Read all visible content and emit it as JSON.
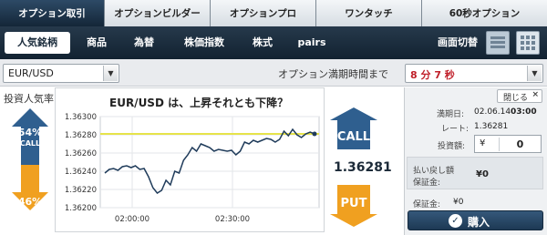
{
  "top_tabs": [
    {
      "label": "オプション取引",
      "active": true
    },
    {
      "label": "オプションビルダー",
      "active": false
    },
    {
      "label": "オプションプロ",
      "active": false
    },
    {
      "label": "ワンタッチ",
      "active": false
    },
    {
      "label": "60秒オプション",
      "active": false
    }
  ],
  "sub_nav": {
    "items": [
      {
        "label": "人気銘柄",
        "active": true
      },
      {
        "label": "商品",
        "active": false
      },
      {
        "label": "為替",
        "active": false
      },
      {
        "label": "株価指数",
        "active": false
      },
      {
        "label": "株式",
        "active": false
      },
      {
        "label": "pairs",
        "active": false
      }
    ],
    "view_toggle_label": "画面切替"
  },
  "selector": {
    "pair": "EUR/USD",
    "expiry_label": "オプション満期時間まで",
    "expiry_value": "8 分 7 秒"
  },
  "sentiment": {
    "title": "投資人気率",
    "call_percent": "54%",
    "call_label": "CALL",
    "put_percent": "46%",
    "put_label": "PUT"
  },
  "chart": {
    "question": "EUR/USD は、上昇それとも下降？"
  },
  "trade": {
    "call_label": "CALL",
    "put_label": "PUT",
    "current_price": "1.36281",
    "colors": {
      "call": "#2f5f8f",
      "put": "#f0a020"
    }
  },
  "panel": {
    "close_label": "閉じる",
    "expiry_date_label": "満期日:",
    "expiry_date_value": "02.06.14",
    "expiry_time_value": "03:00",
    "rate_label": "レート:",
    "rate_value": "1.36281",
    "amount_label": "投資額:",
    "amount_currency": "¥",
    "amount_value": "0",
    "payout_label": "払い戻し額",
    "margin_label": "保証金:",
    "payout_value": "¥0",
    "margin_label2": "保証金:",
    "margin_value": "¥0",
    "buy_label": "購入"
  },
  "chart_data": {
    "type": "line",
    "title": "EUR/USD は、上昇それとも下降？",
    "xlabel": "",
    "ylabel": "",
    "yticks": [
      "1.36300",
      "1.36280",
      "1.36260",
      "1.36240",
      "1.36220",
      "1.36200"
    ],
    "xticks": [
      "02:00:00",
      "02:30:00"
    ],
    "ylim": [
      1.362,
      1.363
    ],
    "grid": true,
    "reference_line": 1.36281,
    "series": [
      {
        "values": [
          1.36238,
          1.36242,
          1.36243,
          1.36241,
          1.36245,
          1.36246,
          1.36244,
          1.36246,
          1.36242,
          1.36243,
          1.36234,
          1.36222,
          1.36216,
          1.36219,
          1.3623,
          1.36225,
          1.3624,
          1.36238,
          1.36252,
          1.36258,
          1.36266,
          1.36262,
          1.3627,
          1.36268,
          1.36266,
          1.36262,
          1.36264,
          1.36263,
          1.36262,
          1.36263,
          1.36258,
          1.36262,
          1.36272,
          1.3627,
          1.36274,
          1.36272,
          1.36274,
          1.36276,
          1.36275,
          1.36272,
          1.36275,
          1.36284,
          1.36279,
          1.36286,
          1.3628,
          1.36277,
          1.36281,
          1.36283,
          1.36281
        ]
      }
    ]
  }
}
